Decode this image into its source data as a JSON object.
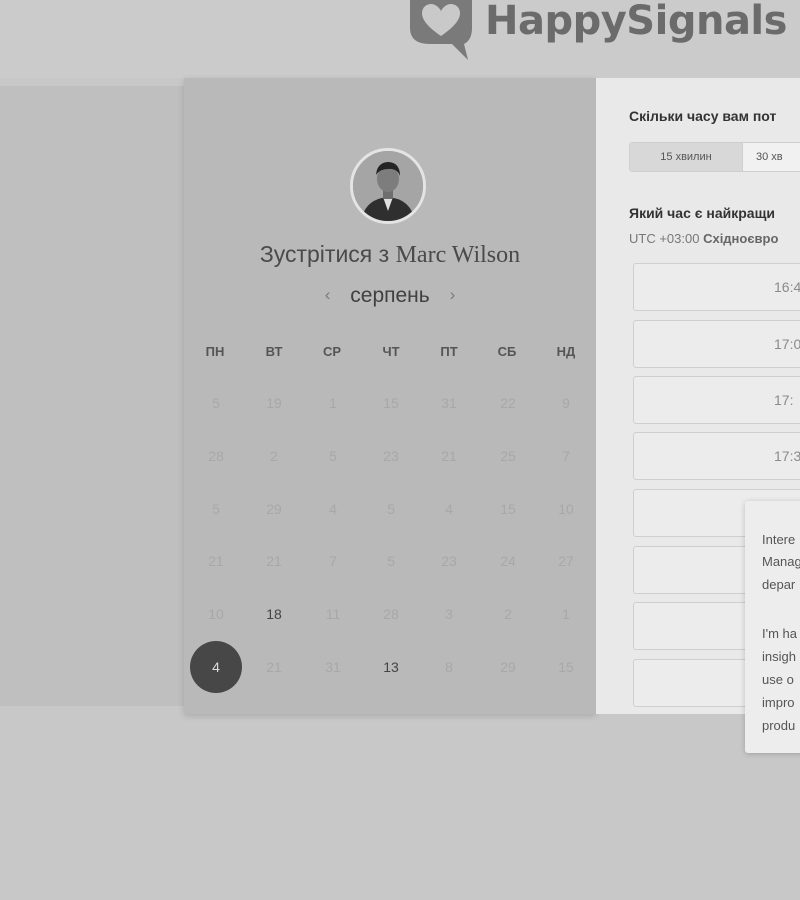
{
  "header": {
    "logo_text": "HappySignals",
    "logo_icon": "heart-speech-bubble-icon"
  },
  "calendar": {
    "title_prefix": "Зустрітися з",
    "host_name": "Marc Wilson",
    "avatar": "person-avatar",
    "month": "серпень",
    "prev_icon": "‹",
    "next_icon": "›",
    "weekdays": [
      "ПН",
      "ВТ",
      "СР",
      "ЧТ",
      "ПТ",
      "СБ",
      "НД"
    ],
    "weeks": [
      [
        "5",
        "19",
        "1",
        "15",
        "31",
        "22",
        "9"
      ],
      [
        "28",
        "2",
        "5",
        "23",
        "21",
        "25",
        "7"
      ],
      [
        "5",
        "29",
        "4",
        "5",
        "4",
        "15",
        "10"
      ],
      [
        "21",
        "21",
        "7",
        "5",
        "23",
        "24",
        "27"
      ],
      [
        "10",
        "18",
        "11",
        "28",
        "3",
        "2",
        "1"
      ],
      [
        "4",
        "21",
        "31",
        "13",
        "8",
        "29",
        "15"
      ]
    ],
    "available": [
      [
        4,
        1
      ],
      [
        5,
        3
      ]
    ],
    "selected": [
      5,
      0
    ]
  },
  "scheduler": {
    "duration_question": "Скільки часу вам пот",
    "duration_options": [
      "15 хвилин",
      "30 хв"
    ],
    "time_question": "Який час є найкращи",
    "timezone_offset": "UTC +03:00",
    "timezone_name": "Східноєвро",
    "slots": [
      "16:4",
      "17:0",
      "17:",
      "17:3",
      "",
      "",
      "",
      ""
    ]
  },
  "popup": {
    "lines": [
      "Intere",
      "Manag",
      "depar",
      "",
      "I'm ha",
      "insigh",
      "use o",
      "impro",
      "produ"
    ]
  },
  "colors": {
    "selected_day": "#474747",
    "panel_left": "#b9b9b9",
    "panel_right": "#e9e9e9"
  }
}
